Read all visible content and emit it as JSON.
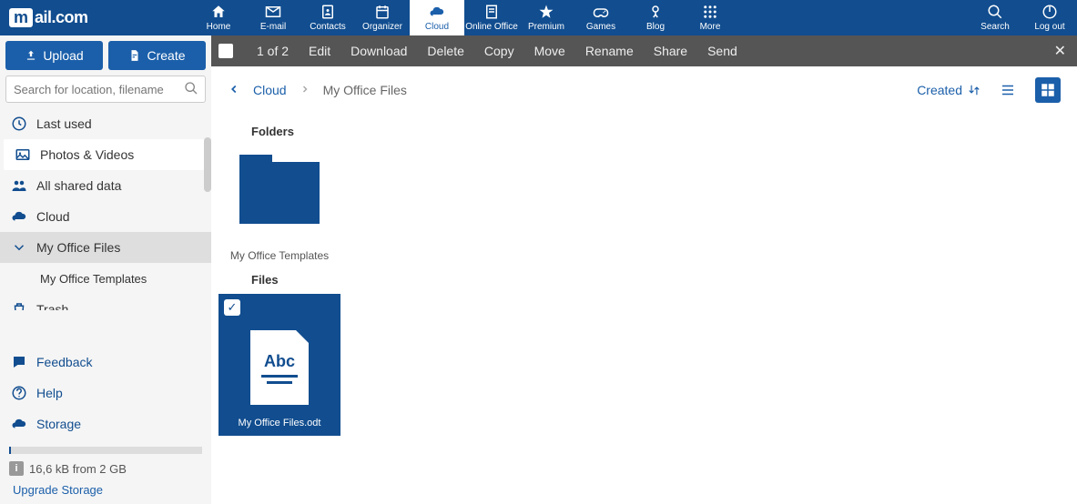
{
  "logo": {
    "first": "m",
    "rest": "ail.com"
  },
  "nav": [
    {
      "label": "Home"
    },
    {
      "label": "E-mail"
    },
    {
      "label": "Contacts"
    },
    {
      "label": "Organizer"
    },
    {
      "label": "Cloud",
      "active": true
    },
    {
      "label": "Online Office"
    },
    {
      "label": "Premium"
    },
    {
      "label": "Games"
    },
    {
      "label": "Blog"
    },
    {
      "label": "More"
    }
  ],
  "nav_right": [
    {
      "label": "Search"
    },
    {
      "label": "Log out"
    }
  ],
  "buttons": {
    "upload": "Upload",
    "create": "Create"
  },
  "search": {
    "placeholder": "Search for location, filename"
  },
  "tree": [
    {
      "label": "Last used",
      "icon": "clock"
    },
    {
      "label": "Photos & Videos",
      "icon": "photo",
      "white": true
    },
    {
      "label": "All shared data",
      "icon": "people"
    },
    {
      "label": "Cloud",
      "icon": "cloud"
    },
    {
      "label": "My Office Files",
      "icon": "chev",
      "selected": true
    },
    {
      "label": "My Office Templates",
      "sub": true
    },
    {
      "label": "Trash",
      "icon": "trash"
    }
  ],
  "links": [
    {
      "label": "Feedback",
      "icon": "chat"
    },
    {
      "label": "Help",
      "icon": "help"
    },
    {
      "label": "Storage",
      "icon": "cloud"
    }
  ],
  "storage": {
    "text": "16,6 kB from 2 GB",
    "upgrade": "Upgrade Storage"
  },
  "actionbar": {
    "count": "1 of 2",
    "items": [
      "Edit",
      "Download",
      "Delete",
      "Copy",
      "Move",
      "Rename",
      "Share",
      "Send"
    ]
  },
  "breadcrumb": {
    "root": "Cloud",
    "current": "My Office Files",
    "sort": "Created"
  },
  "sections": {
    "folders": "Folders",
    "files": "Files"
  },
  "folders": [
    {
      "name": "My Office Templates"
    }
  ],
  "files": [
    {
      "name": "My Office Files.odt",
      "selected": true,
      "abc": "Abc"
    }
  ]
}
